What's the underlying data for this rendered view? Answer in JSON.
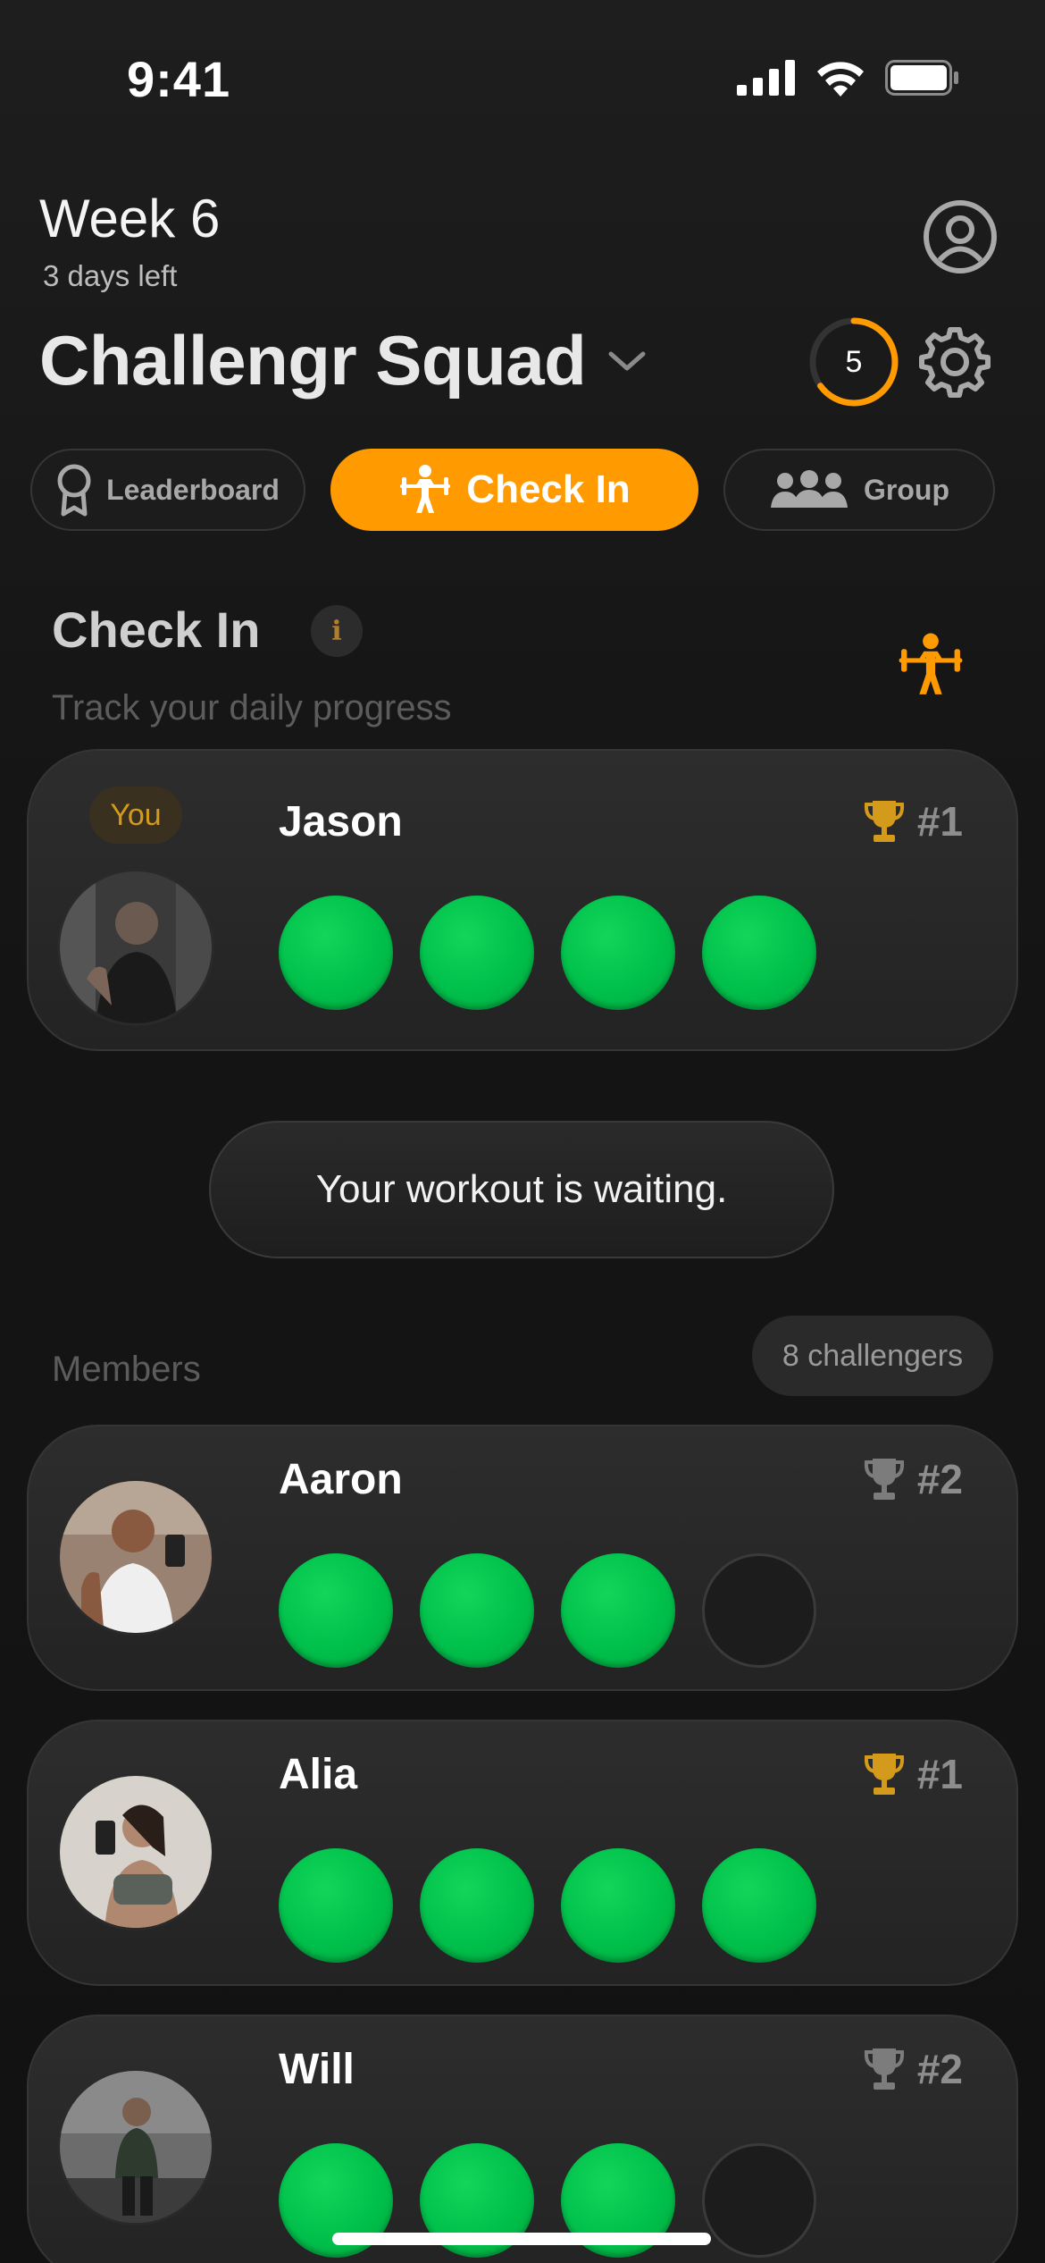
{
  "status_bar": {
    "time": "9:41"
  },
  "header": {
    "week": "Week 6",
    "days_left": "3 days left",
    "squad_name": "Challengr Squad",
    "streak_count": "5",
    "streak_progress": 0.65,
    "accent_color": "#ff9a00"
  },
  "tabs": {
    "leaderboard": "Leaderboard",
    "check_in": "Check In",
    "group": "Group",
    "active": "check_in"
  },
  "section": {
    "title": "Check In",
    "info_icon": "i",
    "subtitle": "Track your daily progress"
  },
  "me": {
    "badge": "You",
    "name": "Jason",
    "rank": "#1",
    "trophy": "gold",
    "checkins": [
      true,
      true,
      true,
      true
    ]
  },
  "nudge": "Your workout is waiting.",
  "members_label": "Members",
  "challengers": "8 challengers",
  "members": [
    {
      "name": "Aaron",
      "rank": "#2",
      "trophy": "silver",
      "checkins": [
        true,
        true,
        true,
        false
      ]
    },
    {
      "name": "Alia",
      "rank": "#1",
      "trophy": "gold",
      "checkins": [
        true,
        true,
        true,
        true
      ]
    },
    {
      "name": "Will",
      "rank": "#2",
      "trophy": "silver",
      "checkins": [
        true,
        true,
        true,
        false
      ]
    }
  ],
  "colors": {
    "done": "#00c04b",
    "gold": "#d39a1c",
    "silver": "#7c7c7c"
  }
}
